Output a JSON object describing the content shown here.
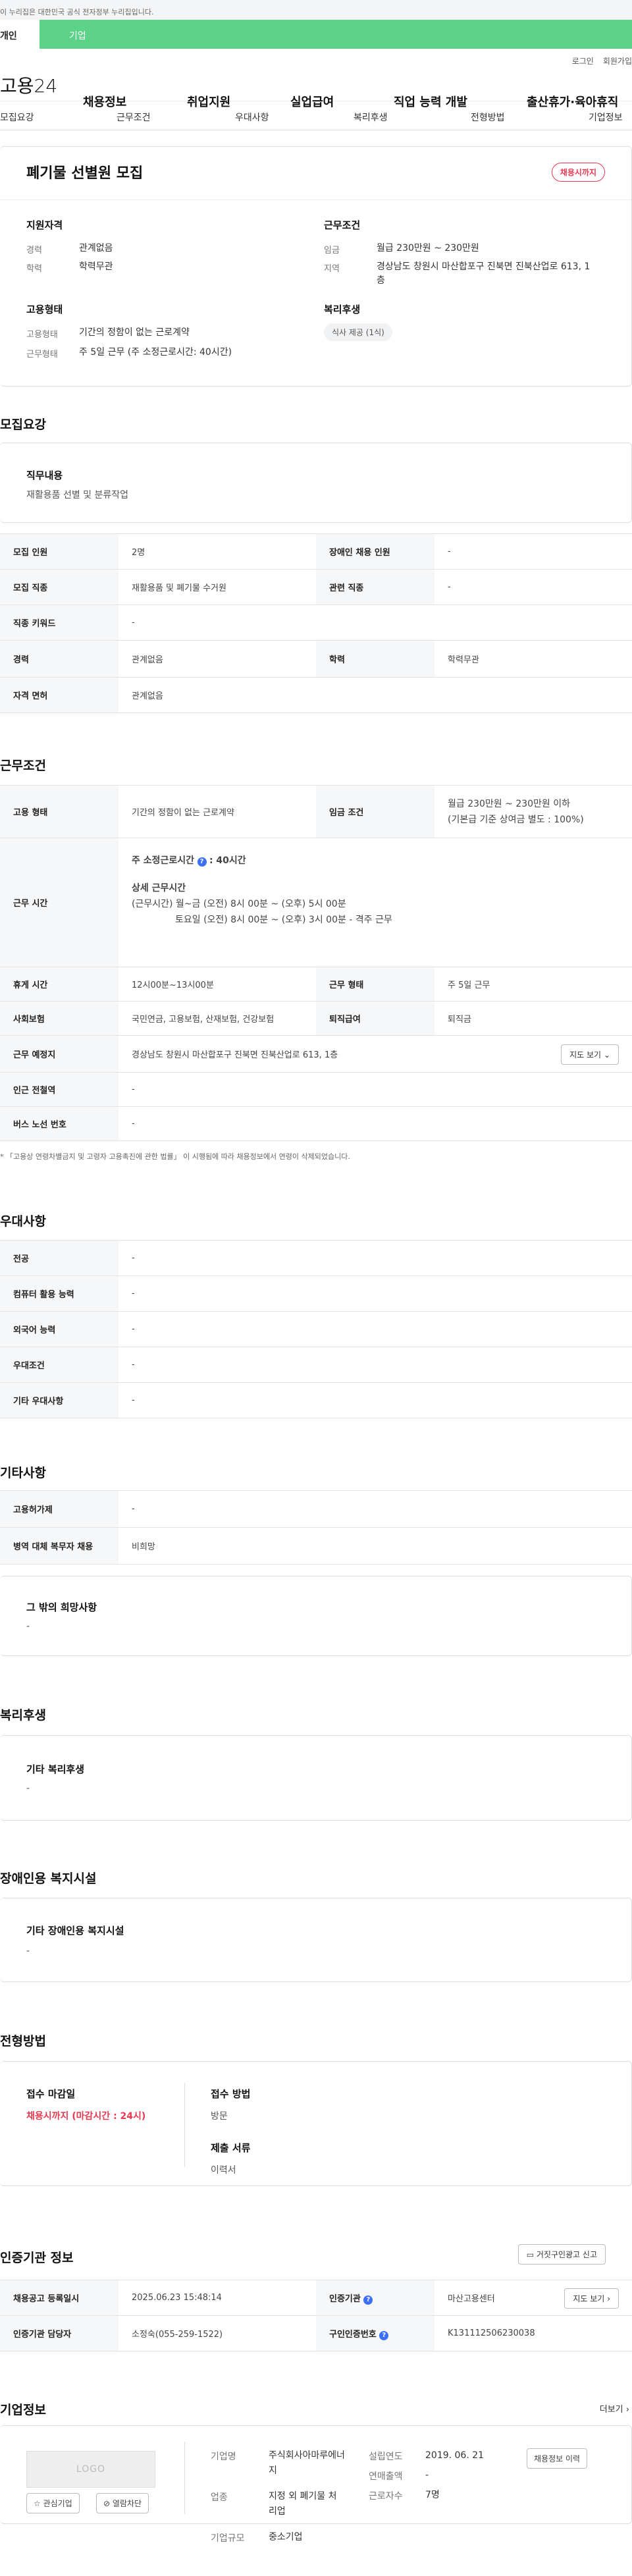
{
  "gov_banner": "이 누리집은 대한민국 공식 전자정부 누리집입니다.",
  "tabs": {
    "individual": "개인",
    "business": "기업"
  },
  "util": {
    "login": "로그인",
    "join": "회원가입"
  },
  "logo": "고용24",
  "gnb": [
    "채용정보",
    "취업지원",
    "실업급여",
    "직업 능력 개발",
    "출산휴가·육아휴직"
  ],
  "anchor_nav": [
    "모집요강",
    "근무조건",
    "우대사항",
    "복리후생",
    "전형방법",
    "기업정보"
  ],
  "summary": {
    "title": "폐기물 선별원 모집",
    "badge": "채용시까지",
    "qual_heading": "지원자격",
    "career_label": "경력",
    "career_value": "관계없음",
    "edu_label": "학력",
    "edu_value": "학력무관",
    "cond_heading": "근무조건",
    "wage_label": "임금",
    "wage_value": "월급 230만원 ~ 230만원",
    "region_label": "지역",
    "region_value_1": "경상남도 창원시 마산합포구 진북면 진북산업로 613, 1",
    "region_value_2": "층",
    "emp_heading": "고용형태",
    "emp_type_label": "고용형태",
    "emp_type_value": "기간의 정함이 없는 근로계약",
    "work_type_label": "근무형태",
    "work_type_value": "주 5일 근무 (주 소정근로시간: 40시간)",
    "welfare_heading": "복리후생",
    "welfare_chip": "식사 제공 (1식)"
  },
  "recruit": {
    "heading": "모집요강",
    "duty_label": "직무내용",
    "duty_value": "재활용품 선별 및 분류작업",
    "rows": {
      "headcount_k": "모집 인원",
      "headcount_v": "2명",
      "disabled_k": "장애인 채용 인원",
      "disabled_v": "-",
      "job_k": "모집 직종",
      "job_v": "재활용품 및 폐기물 수거원",
      "related_k": "관련 직종",
      "related_v": "-",
      "keyword_k": "직종 키워드",
      "keyword_v": "-",
      "career_k": "경력",
      "career_v": "관계없음",
      "edu_k": "학력",
      "edu_v": "학력무관",
      "license_k": "자격 면허",
      "license_v": "관계없음"
    }
  },
  "conditions": {
    "heading": "근무조건",
    "emp_k": "고용 형태",
    "emp_v": "기간의 정함이 없는 근로계약",
    "wage_k": "임금 조건",
    "wage_v1": "월급 230만원 ~ 230만원 이하",
    "wage_v2": "(기본급 기준 상여금 별도 : 100%)",
    "hours_k": "근무 시간",
    "hours_week_label": "주 소정근로시간",
    "hours_week_value": ": 40시간",
    "hours_detail_label": "상세 근무시간",
    "hours_detail_1": "(근무시간) 월~금 (오전) 8시 00분 ~ (오후) 5시 00분",
    "hours_detail_2": "토요일 (오전) 8시 00분 ~ (오후) 3시  00분 - 격주 근무",
    "rest_k": "휴게 시간",
    "rest_v": "12시00분~13시00분",
    "worktype_k": "근무 형태",
    "worktype_v": "주 5일 근무",
    "insurance_k": "사회보험",
    "insurance_v": "국민연금, 고용보험, 산재보험, 건강보험",
    "severance_k": "퇴직급여",
    "severance_v": "퇴직금",
    "place_k": "근무 예정지",
    "place_v": "경상남도 창원시 마산합포구 진북면 진북산업로 613, 1층",
    "map_btn": "지도 보기",
    "subway_k": "인근 전철역",
    "subway_v": "-",
    "bus_k": "버스 노선 번호",
    "bus_v": "-",
    "note": "* 「고용상 연령차별금지 및 고령자 고용촉진에 관한 법률」 이 시행됨에 따라 채용정보에서 연령이 삭제되었습니다."
  },
  "preference": {
    "heading": "우대사항",
    "rows": [
      {
        "k": "전공",
        "v": "-"
      },
      {
        "k": "컴퓨터 활용 능력",
        "v": "-"
      },
      {
        "k": "외국어 능력",
        "v": "-"
      },
      {
        "k": "우대조건",
        "v": "-"
      },
      {
        "k": "기타 우대사항",
        "v": "-"
      }
    ]
  },
  "etc": {
    "heading": "기타사항",
    "rows": [
      {
        "k": "고용허가제",
        "v": "-"
      },
      {
        "k": "병역 대체 복무자 채용",
        "v": "비희망"
      }
    ],
    "wish_label": "그 밖의 희망사항",
    "wish_value": "-"
  },
  "welfare": {
    "heading": "복리후생",
    "label": "기타 복리후생",
    "value": "-"
  },
  "disability": {
    "heading": "장애인용 복지시설",
    "label": "기타 장애인용 복지시설",
    "value": "-"
  },
  "selection": {
    "heading": "전형방법",
    "deadline_label": "접수 마감일",
    "deadline_value": "채용시까지 (마감시간 : 24시)",
    "method_label": "접수 방법",
    "method_value": "방문",
    "docs_label": "제출 서류",
    "docs_value": "이력서"
  },
  "agency": {
    "heading": "인증기관 정보",
    "report_btn": "거짓구인광고 신고",
    "reg_k": "채용공고 등록일시",
    "reg_v": "2025.06.23 15:48:14",
    "cert_k": "인증기관",
    "cert_v": "마산고용센터",
    "manager_k": "인증기관 담당자",
    "manager_v": "소정숙(055-259-1522)",
    "num_k": "구인인증번호",
    "num_v": "K131112506230038",
    "map_btn": "지도 보기"
  },
  "company": {
    "heading": "기업정보",
    "more": "더보기",
    "logo_text": "LOGO",
    "interest_btn": "관심기업",
    "block_btn": "열람차단",
    "name_k": "기업명",
    "name_v1": "주식회사아마루에너",
    "name_v2": "지",
    "industry_k": "업종",
    "industry_v1": "지정 외 폐기물 처",
    "industry_v2": "리업",
    "size_k": "기업규모",
    "size_v": "중소기업",
    "year_k": "설립연도",
    "year_v": "2019. 06. 21",
    "sales_k": "연매출액",
    "sales_v": "-",
    "emp_k": "근로자수",
    "emp_v": "7명",
    "history_btn": "채용정보 이력"
  }
}
